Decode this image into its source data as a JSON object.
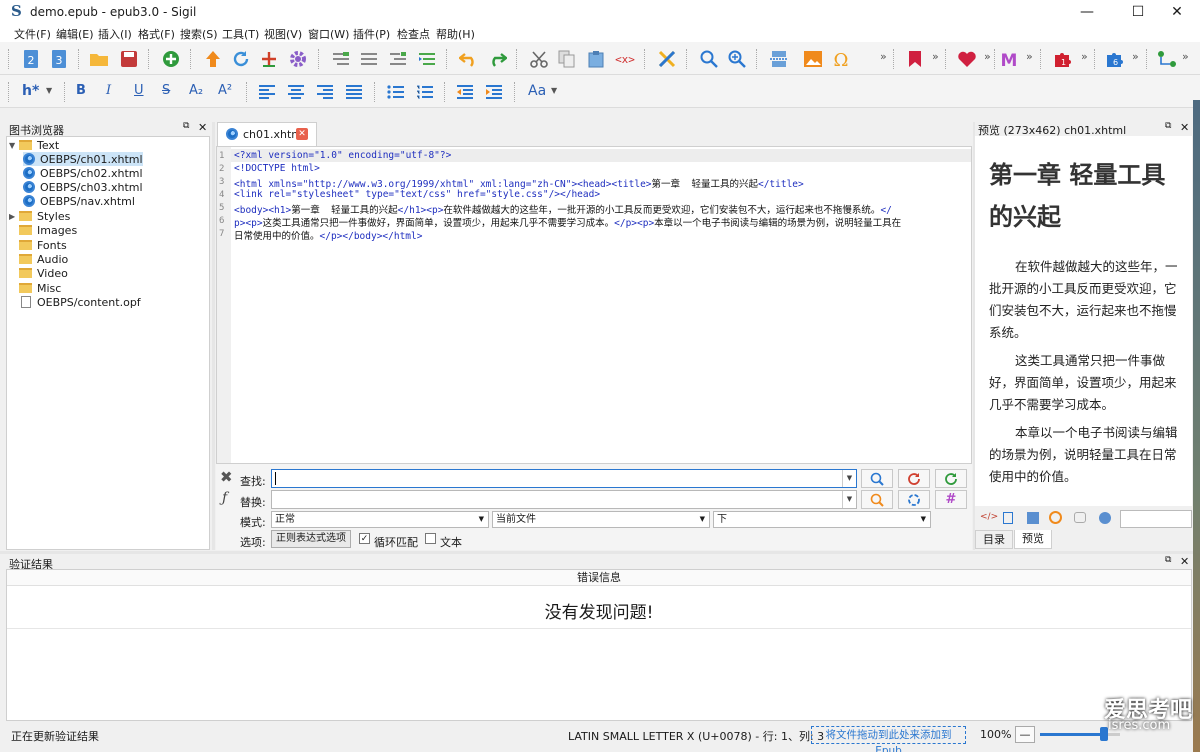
{
  "window": {
    "title": "demo.epub - epub3.0 - Sigil",
    "logo": "S"
  },
  "window_controls": {
    "minimize": "—",
    "maximize": "☐",
    "close": "✕"
  },
  "menu": [
    "文件(F)",
    "编辑(E)",
    "插入(I)",
    "格式(F)",
    "搜索(S)",
    "工具(T)",
    "视图(V)",
    "窗口(W)",
    "插件(P)",
    "检查点",
    "帮助(H)"
  ],
  "toolbar2": {
    "heading": "h*",
    "bold": "B",
    "italic": "I",
    "underline": "U",
    "strike": "S",
    "sub": "A₂",
    "sup": "A²",
    "case": "Aa"
  },
  "book_browser": {
    "title": "图书浏览器",
    "items": [
      {
        "label": "Text",
        "kind": "folder",
        "level": 0,
        "expanded": true
      },
      {
        "label": "OEBPS/ch01.xhtml",
        "kind": "xhtml",
        "level": 1,
        "selected": true
      },
      {
        "label": "OEBPS/ch02.xhtml",
        "kind": "xhtml",
        "level": 1
      },
      {
        "label": "OEBPS/ch03.xhtml",
        "kind": "xhtml",
        "level": 1
      },
      {
        "label": "OEBPS/nav.xhtml",
        "kind": "xhtml",
        "level": 1
      },
      {
        "label": "Styles",
        "kind": "folder",
        "level": 0,
        "collapsed": true
      },
      {
        "label": "Images",
        "kind": "folder",
        "level": 0
      },
      {
        "label": "Fonts",
        "kind": "folder",
        "level": 0
      },
      {
        "label": "Audio",
        "kind": "folder",
        "level": 0
      },
      {
        "label": "Video",
        "kind": "folder",
        "level": 0
      },
      {
        "label": "Misc",
        "kind": "folder",
        "level": 0
      },
      {
        "label": "OEBPS/content.opf",
        "kind": "file",
        "level": 0
      }
    ]
  },
  "editor": {
    "tab": "ch01.xhtml",
    "line_numbers": [
      "1",
      "2",
      "3",
      "4",
      "5",
      "6",
      "7"
    ],
    "lines": {
      "l1": "<?xml version=\"1.0\" encoding=\"utf-8\"?>",
      "l2": "<!DOCTYPE html>",
      "l3a": "<html xmlns=\"http://www.w3.org/1999/xhtml\" xml:lang=\"zh-CN\"><head><title>",
      "l3b": "第一章  轻量工具的兴起",
      "l3c": "</title>",
      "l4": "<link rel=\"stylesheet\" type=\"text/css\" href=\"style.css\"/></head>",
      "l5a": "<body><h1>",
      "l5b": "第一章  轻量工具的兴起",
      "l5c": "</h1><p>",
      "l5d": "在软件越做越大的这些年，一批开源的小工具反而更受欢迎，它们安装包不大，运行起来也不拖慢系统。",
      "l5e": "</",
      "l6a": "p><p>",
      "l6b": "这类工具通常只把一件事做好，界面简单，设置项少，用起来几乎不需要学习成本。",
      "l6c": "</p><p>",
      "l6d": "本章以一个电子书阅读与编辑的场景为例，说明轻量工具在",
      "l7a": "日常使用中的价值。",
      "l7b": "</p></body></html>"
    }
  },
  "find_replace": {
    "find_label": "查找:",
    "replace_label": "替换:",
    "mode_label": "模式:",
    "options_label": "选项:",
    "mode_value": "正常",
    "scope_value": "当前文件",
    "direction_value": "下",
    "regex_button": "正则表达式选项",
    "wrap_label": "循环匹配",
    "wrap_checked": true,
    "text_label": "文本",
    "text_checked": false,
    "find_value": "",
    "replace_value": ""
  },
  "preview": {
    "title": "预览 (273x462) ch01.xhtml",
    "heading": "第一章 轻量工具的兴起",
    "paragraphs": [
      "在软件越做越大的这些年，一批开源的小工具反而更受欢迎，它们安装包不大，运行起来也不拖慢系统。",
      "这类工具通常只把一件事做好，界面简单，设置项少，用起来几乎不需要学习成本。",
      "本章以一个电子书阅读与编辑的场景为例，说明轻量工具在日常使用中的价值。"
    ],
    "tabs": [
      "目录",
      "预览"
    ]
  },
  "validation": {
    "title": "验证结果",
    "column": "错误信息",
    "message": "没有发现问题!"
  },
  "status": {
    "left": "正在更新验证结果",
    "char": "LATIN SMALL LETTER X (U+0078) - 行: 1、列: 3",
    "dropzone": "将文件拖动到此处来添加到 Epub",
    "zoom": "100%",
    "zoom_fraction": 0.8
  },
  "watermark": {
    "main": "爱思考吧",
    "sub": "isres.com"
  },
  "colors": {
    "accent": "#2a77d0",
    "selection": "#cce4f7",
    "folder": "#f2c95c"
  }
}
